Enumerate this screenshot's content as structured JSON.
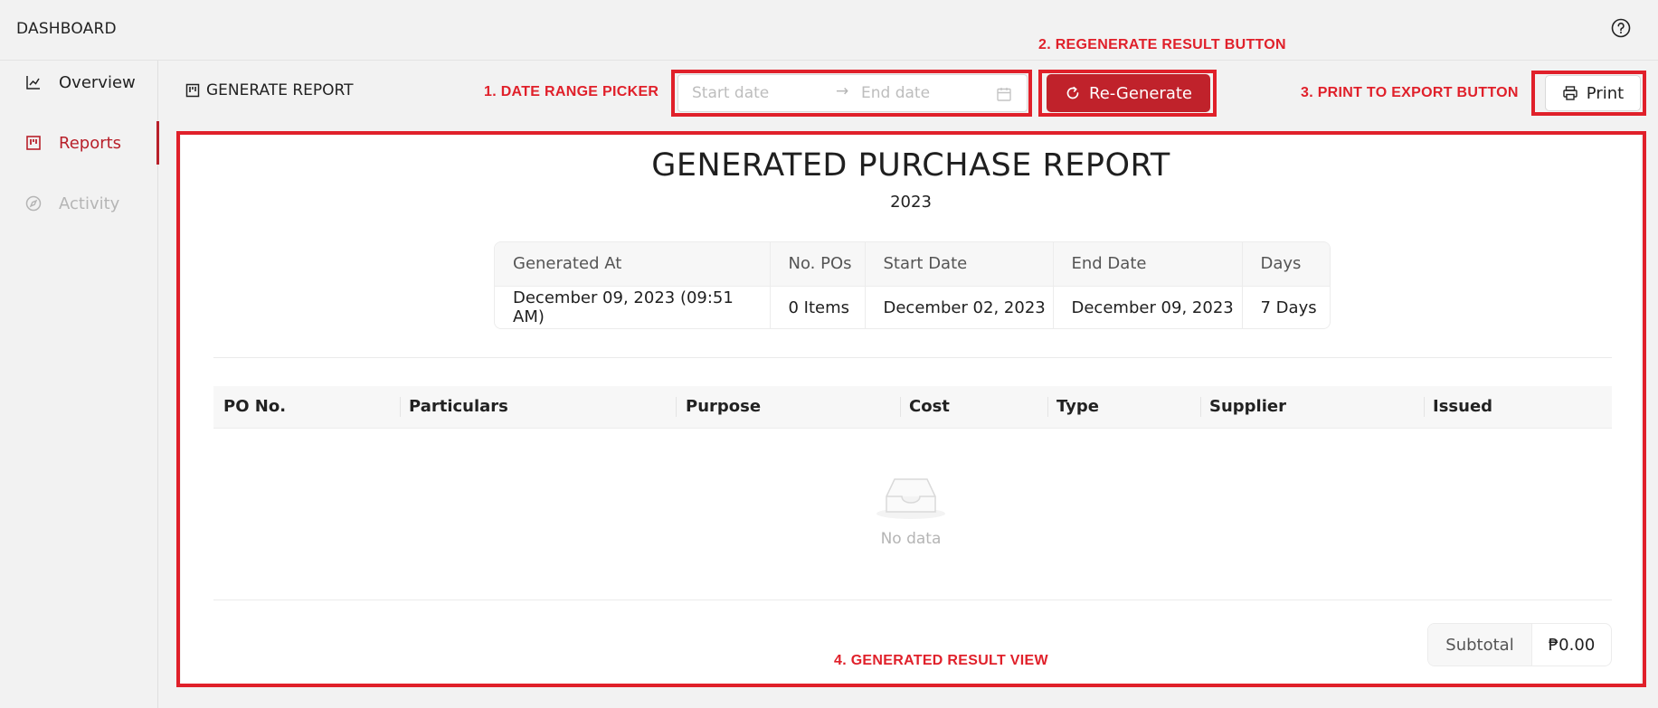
{
  "app": {
    "title": "DASHBOARD",
    "help_icon": "help-circle-icon"
  },
  "sidebar": {
    "items": [
      {
        "label": "Overview",
        "icon": "line-chart-icon",
        "state": "normal"
      },
      {
        "label": "Reports",
        "icon": "project-board-icon",
        "state": "active"
      },
      {
        "label": "Activity",
        "icon": "compass-icon",
        "state": "disabled"
      }
    ]
  },
  "toolbar": {
    "title": "GENERATE REPORT",
    "date_range": {
      "start_placeholder": "Start date",
      "end_placeholder": "End date",
      "arrow": "→"
    },
    "regenerate_label": "Re-Generate",
    "print_label": "Print"
  },
  "annotations": {
    "date_range_picker": "1. DATE RANGE PICKER",
    "regenerate_button": "2. REGENERATE RESULT BUTTON",
    "print_button": "3. PRINT TO EXPORT BUTTON",
    "result_view": "4. GENERATED RESULT VIEW"
  },
  "report": {
    "title": "GENERATED PURCHASE REPORT",
    "year": "2023",
    "meta": {
      "headers": [
        "Generated At",
        "No. POs",
        "Start Date",
        "End Date",
        "Days"
      ],
      "values": [
        "December 09, 2023 (09:51 AM)",
        "0 Items",
        "December 02, 2023",
        "December 09, 2023",
        "7 Days"
      ]
    },
    "po_table": {
      "columns": [
        "PO No.",
        "Particulars",
        "Purpose",
        "Cost",
        "Type",
        "Supplier",
        "Issued"
      ],
      "rows": [],
      "empty_text": "No data"
    },
    "subtotal": {
      "label": "Subtotal",
      "value": "₱0.00"
    }
  },
  "colors": {
    "accent": "#c0222b",
    "annotation": "#e0202a",
    "background": "#f2f2f2"
  }
}
